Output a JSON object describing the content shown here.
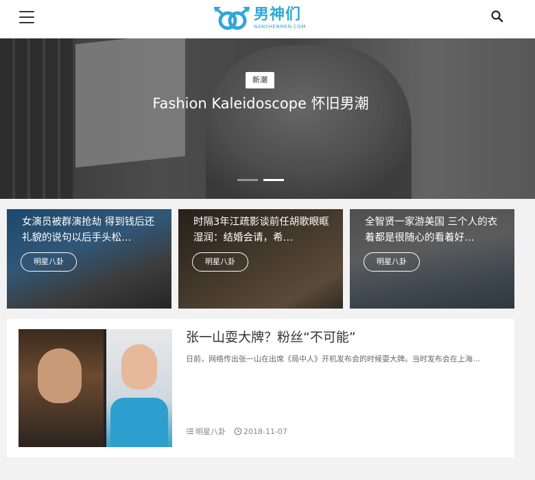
{
  "header": {
    "logo_cn": "男神们",
    "logo_en": "NANSHENMEN.COM"
  },
  "hero": {
    "tag": "新潮",
    "title": "Fashion Kaleidoscope 怀旧男潮",
    "slides_total": 2,
    "active_slide": 2
  },
  "cards": [
    {
      "title": "女演员被群演抢劫 得到钱后还礼貌的说句以后手头松…",
      "tag": "明星八卦"
    },
    {
      "title": "时隔3年江疏影谈前任胡歌眼眶湿润：结婚会请，希…",
      "tag": "明星八卦"
    },
    {
      "title": "全智贤一家游美国 三个人的衣着都是很随心的看着好…",
      "tag": "明星八卦"
    }
  ],
  "article": {
    "title": "张一山耍大牌？粉丝“不可能”",
    "excerpt": "日前，网络传出张一山在出席《局中人》开机发布会的时候耍大牌。当时发布会在上海…",
    "category": "明星八卦",
    "date": "2018-11-07"
  },
  "colors": {
    "brand": "#2fa8d8",
    "header_bg": "#ffffff",
    "page_bg": "#f2f2f2"
  },
  "icons": {
    "menu": "hamburger-menu-icon",
    "search": "search-icon",
    "category": "list-icon",
    "date": "clock-icon"
  }
}
